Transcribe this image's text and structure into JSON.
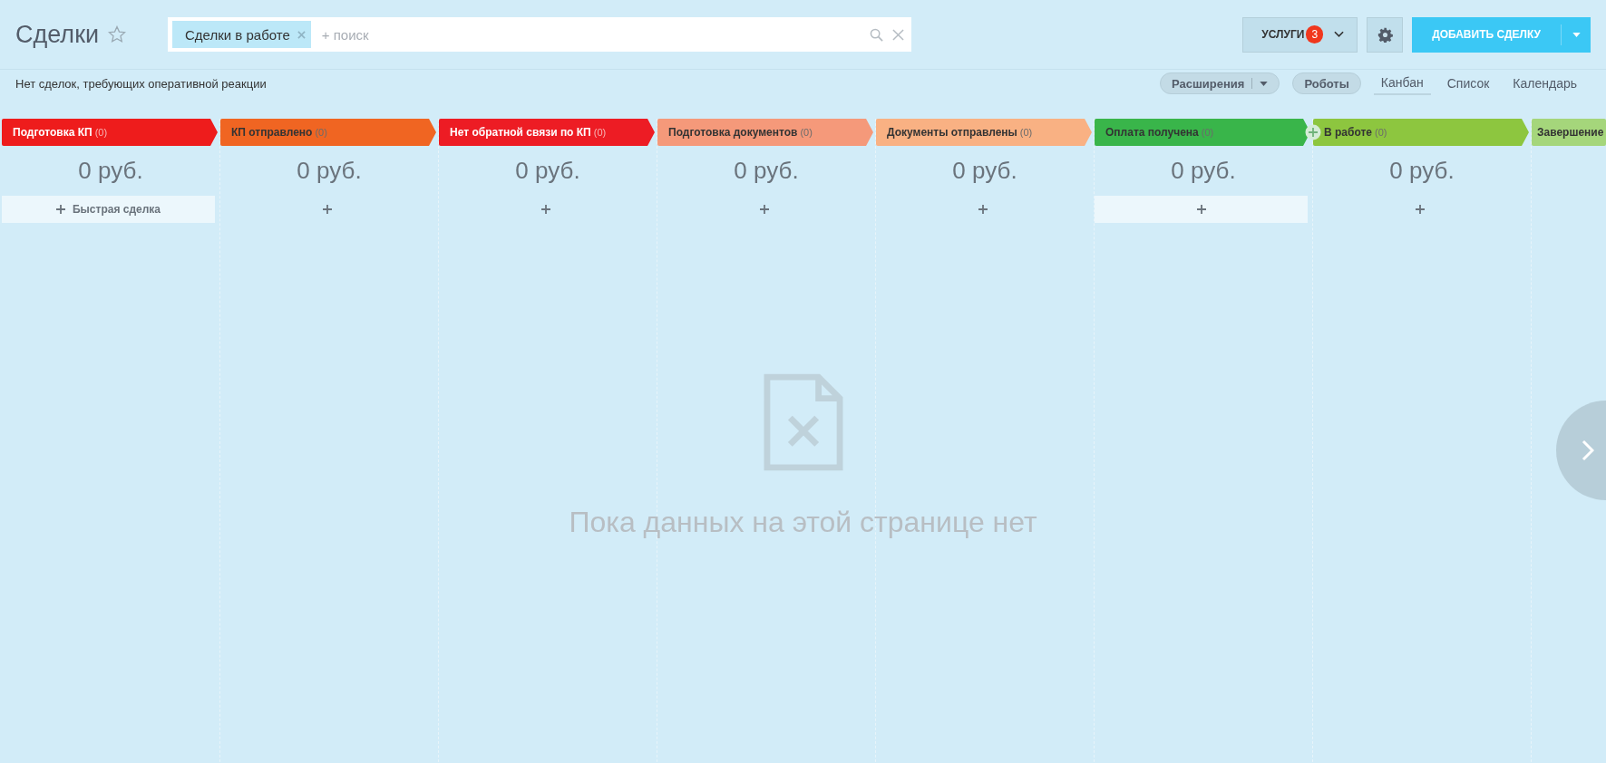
{
  "header": {
    "title": "Сделки",
    "filter_tag": "Сделки в работе",
    "search_placeholder": "+ поиск",
    "services_button": "УСЛУГИ",
    "services_badge": "3",
    "add_button": "ДОБАВИТЬ СДЕЛКУ"
  },
  "subbar": {
    "notice": "Нет сделок, требующих оперативной реакции",
    "extensions_button": "Расширения",
    "robots_button": "Роботы",
    "views": [
      {
        "label": "Канбан",
        "selected": true
      },
      {
        "label": "Список",
        "selected": false
      },
      {
        "label": "Календарь",
        "selected": false
      }
    ]
  },
  "stages": [
    {
      "name": "Подготовка КП",
      "count": "(0)",
      "color": "#ee1c1c",
      "light_text": true,
      "sum": "0 руб.",
      "add_label": "Быстрая сделка",
      "add_highlighted": true,
      "insert_button": false
    },
    {
      "name": "КП отправлено",
      "count": "(0)",
      "color": "#f06522",
      "light_text": false,
      "sum": "0 руб.",
      "add_highlighted": false,
      "insert_button": false
    },
    {
      "name": "Нет обратной связи по КП",
      "count": "(0)",
      "color": "#ed1c24",
      "light_text": true,
      "sum": "0 руб.",
      "add_highlighted": false,
      "insert_button": false
    },
    {
      "name": "Подготовка документов",
      "count": "(0)",
      "color": "#f5997a",
      "light_text": false,
      "sum": "0 руб.",
      "add_highlighted": false,
      "insert_button": false
    },
    {
      "name": "Документы отправлены",
      "count": "(0)",
      "color": "#f9b183",
      "light_text": false,
      "sum": "0 руб.",
      "add_highlighted": false,
      "insert_button": false
    },
    {
      "name": "Оплата получена",
      "count": "(0)",
      "color": "#39b54a",
      "light_text": false,
      "sum": "0 руб.",
      "add_highlighted": true,
      "insert_button": true
    },
    {
      "name": "В работе",
      "count": "(0)",
      "color": "#8dc63f",
      "light_text": false,
      "sum": "0 руб.",
      "add_highlighted": false,
      "insert_button": false
    },
    {
      "name": "Завершение",
      "color": "#a5d67b",
      "light_text": false
    }
  ],
  "empty_state": {
    "message": "Пока данных на этой странице нет"
  }
}
